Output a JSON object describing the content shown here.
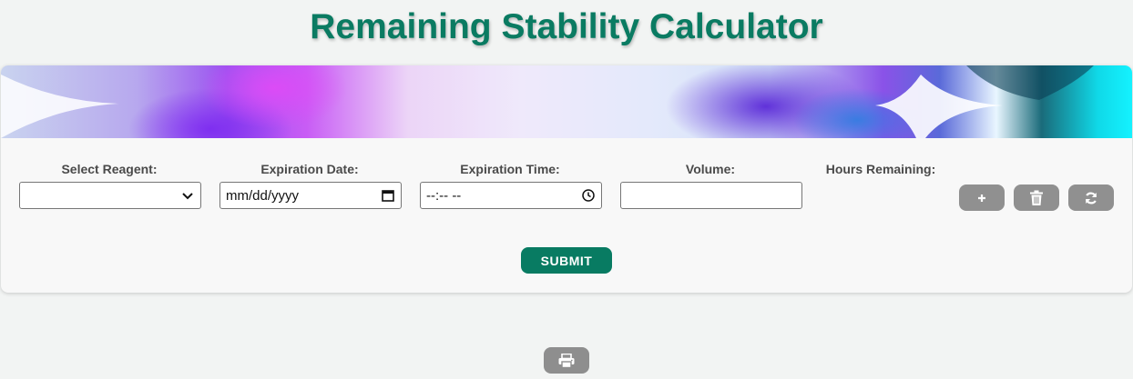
{
  "page": {
    "title": "Remaining Stability Calculator"
  },
  "form": {
    "reagent": {
      "label": "Select Reagent:",
      "selected": ""
    },
    "expiration_date": {
      "label": "Expiration Date:",
      "placeholder": "mm/dd/yyyy"
    },
    "expiration_time": {
      "label": "Expiration Time:",
      "placeholder": "--:-- --"
    },
    "volume": {
      "label": "Volume:",
      "value": ""
    },
    "hours_remaining": {
      "label": "Hours Remaining:"
    }
  },
  "actions": {
    "add_icon": "plus-icon",
    "delete_icon": "trash-icon",
    "reset_icon": "refresh-icon",
    "submit_label": "SUBMIT",
    "print_icon": "printer-icon"
  },
  "colors": {
    "accent": "#087b62",
    "title": "#0a7b62",
    "icon_button": "#909090",
    "background": "#f2f4f3"
  }
}
